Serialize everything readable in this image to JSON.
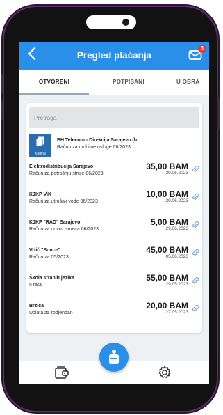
{
  "header": {
    "title": "Pregled plaćanja",
    "notification_count": "3"
  },
  "tabs": [
    {
      "label": "OTVORENI",
      "active": true
    },
    {
      "label": "POTPISANI",
      "active": false
    },
    {
      "label": "U OBRA",
      "active": false
    }
  ],
  "search": {
    "placeholder": "Pretraga"
  },
  "featured_item": {
    "name": "BH Telecom - Direkcija Sarajevo (b..",
    "description": "Račun za mobilne usluge 06/2023",
    "badge_label": "Kopiraj"
  },
  "payments": [
    {
      "name": "Elektrodistribucija Sarajevo",
      "description": "Račun za potrošnju struje 06/2023",
      "amount": "35,00 BAM",
      "date": "29.06.2023"
    },
    {
      "name": "KJKP ViK",
      "description": "Račun za utrošak vode 06/2023",
      "amount": "10,00 BAM",
      "date": "29.06.2023"
    },
    {
      "name": "KJKP \"RAD\"  Sarajevo",
      "description": "Račun za odvoz smeća 06/2023",
      "amount": "5,00 BAM",
      "date": "29.06.2023"
    },
    {
      "name": "Vrtić \"Sunce\"",
      "description": "Račun za 05/2023",
      "amount": "45,00 BAM",
      "date": "05.06.2023"
    },
    {
      "name": "Škola stranih jezika",
      "description": "II rata",
      "amount": "55,00 BAM",
      "date": "29.05.2023"
    },
    {
      "name": "Brzica",
      "description": "Uplata za rodjendan",
      "amount": "20,00 BAM",
      "date": "27.05.2023"
    }
  ],
  "colors": {
    "accent": "#2a8fe8",
    "badge": "#e53935",
    "copy_box": "#2b6bb0",
    "phone_frame": "#5a2f6b"
  },
  "icons": [
    "back-arrow-icon",
    "inbox-icon",
    "copy-icon",
    "paperclip-icon",
    "wallet-icon",
    "bank-icon",
    "settings-gear-icon"
  ]
}
